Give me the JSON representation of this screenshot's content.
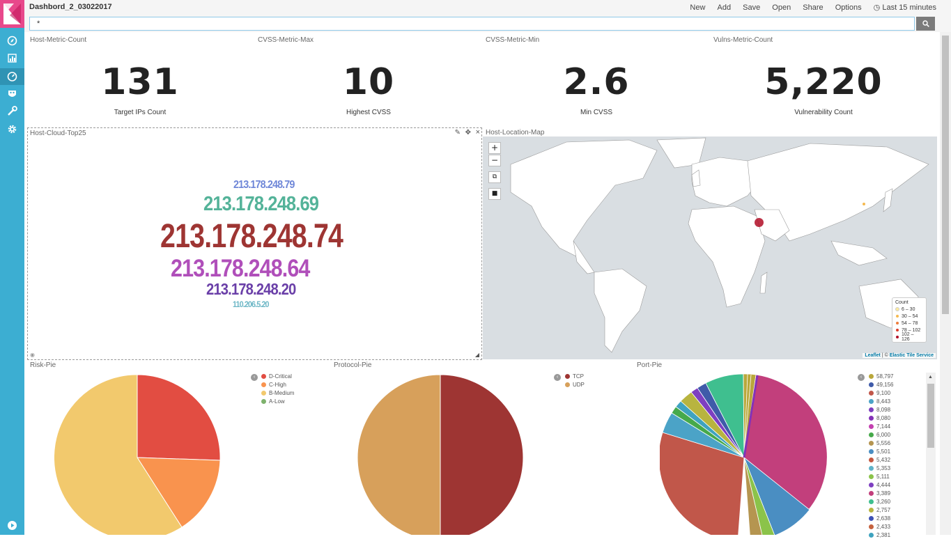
{
  "app": {
    "title": "Dashbord_2_03022017"
  },
  "menu": {
    "new": "New",
    "add": "Add",
    "save": "Save",
    "open": "Open",
    "share": "Share",
    "options": "Options",
    "time": "Last 15 minutes"
  },
  "query": {
    "value": "*"
  },
  "metrics": [
    {
      "title": "Host-Metric-Count",
      "value": "131",
      "label": "Target IPs Count"
    },
    {
      "title": "CVSS-Metric-Max",
      "value": "10",
      "label": "Highest CVSS"
    },
    {
      "title": "CVSS-Metric-Min",
      "value": "2.6",
      "label": "Min CVSS"
    },
    {
      "title": "Vulns-Metric-Count",
      "value": "5,220",
      "label": "Vulnerability Count"
    }
  ],
  "cloud": {
    "title": "Host-Cloud-Top25",
    "words": [
      {
        "text": "213.178.248.79",
        "color": "#6f87d8"
      },
      {
        "text": "213.178.248.69",
        "color": "#54b399"
      },
      {
        "text": "213.178.248.74",
        "color": "#9e3533"
      },
      {
        "text": "213.178.248.64",
        "color": "#b04fba"
      },
      {
        "text": "213.178.248.20",
        "color": "#6a3fa8"
      },
      {
        "text": "110.206.5.20",
        "color": "#6db7c6"
      }
    ]
  },
  "map": {
    "title": "Host-Location-Map",
    "zoom_in": "+",
    "zoom_out": "−",
    "legend_title": "Count",
    "legend": [
      {
        "label": "6 – 30",
        "color": "#fdea9b"
      },
      {
        "label": "30 – 54",
        "color": "#f5b94f"
      },
      {
        "label": "54 – 78",
        "color": "#ee7d3b"
      },
      {
        "label": "78 – 102",
        "color": "#dc3b29"
      },
      {
        "label": "102 – 126",
        "color": "#b00d26"
      }
    ],
    "attribution_leaflet": "Leaflet",
    "attribution_sep": " | © ",
    "attribution_tiles": "Elastic Tile Service"
  },
  "risk_pie": {
    "title": "Risk-Pie",
    "legend": [
      {
        "label": "D-Critical",
        "color": "#e24d42"
      },
      {
        "label": "C-High",
        "color": "#f9934e"
      },
      {
        "label": "B-Medium",
        "color": "#f2c96d"
      },
      {
        "label": "A-Low",
        "color": "#7eb26d"
      }
    ]
  },
  "protocol_pie": {
    "title": "Protocol-Pie",
    "legend": [
      {
        "label": "TCP",
        "color": "#9e3533"
      },
      {
        "label": "UDP",
        "color": "#d7a05b"
      }
    ]
  },
  "port_pie": {
    "title": "Port-Pie",
    "legend": [
      {
        "label": "58,797",
        "color": "#b9a73b"
      },
      {
        "label": "49,156",
        "color": "#3f5ba9"
      },
      {
        "label": "9,100",
        "color": "#c1574a"
      },
      {
        "label": "8,443",
        "color": "#4ba3c7"
      },
      {
        "label": "8,098",
        "color": "#7d3fbf"
      },
      {
        "label": "8,080",
        "color": "#8332b7"
      },
      {
        "label": "7,144",
        "color": "#c340b0"
      },
      {
        "label": "6,000",
        "color": "#46a94b"
      },
      {
        "label": "5,556",
        "color": "#b59550"
      },
      {
        "label": "5,501",
        "color": "#4a8ec2"
      },
      {
        "label": "5,432",
        "color": "#c4573f"
      },
      {
        "label": "5,353",
        "color": "#5fb3c9"
      },
      {
        "label": "5,111",
        "color": "#8bc34a"
      },
      {
        "label": "4,444",
        "color": "#7e3fc1"
      },
      {
        "label": "3,389",
        "color": "#c23f7c"
      },
      {
        "label": "3,260",
        "color": "#3fbf8f"
      },
      {
        "label": "2,757",
        "color": "#b8b43f"
      },
      {
        "label": "2,638",
        "color": "#3f52b5"
      },
      {
        "label": "2,433",
        "color": "#c5623f"
      },
      {
        "label": "2,381",
        "color": "#3fa3bf"
      }
    ]
  }
}
